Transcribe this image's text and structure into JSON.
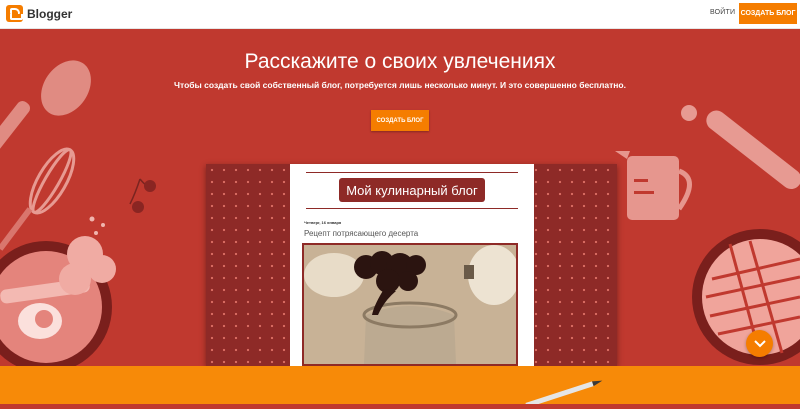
{
  "header": {
    "brand": "Blogger",
    "login_label": "ВОЙТИ",
    "create_label": "СОЗДАТЬ БЛОГ"
  },
  "hero": {
    "title": "Расскажите о своих увлечениях",
    "subtitle": "Чтобы создать свой собственный блог, потребуется лишь несколько минут. И это совершенно бесплатно.",
    "cta_label": "СОЗДАТЬ БЛОГ"
  },
  "preview": {
    "blog_title": "Мой кулинарный блог",
    "post_date": "Четверг, 16 января",
    "post_title": "Рецепт потрясающего десерта"
  },
  "icons": {
    "logo": "blogger-logo-icon",
    "scroll": "chevron-down-icon"
  },
  "colors": {
    "background": "#c0392f",
    "accent": "#f57d00",
    "preview_dark": "#8e2a27"
  }
}
